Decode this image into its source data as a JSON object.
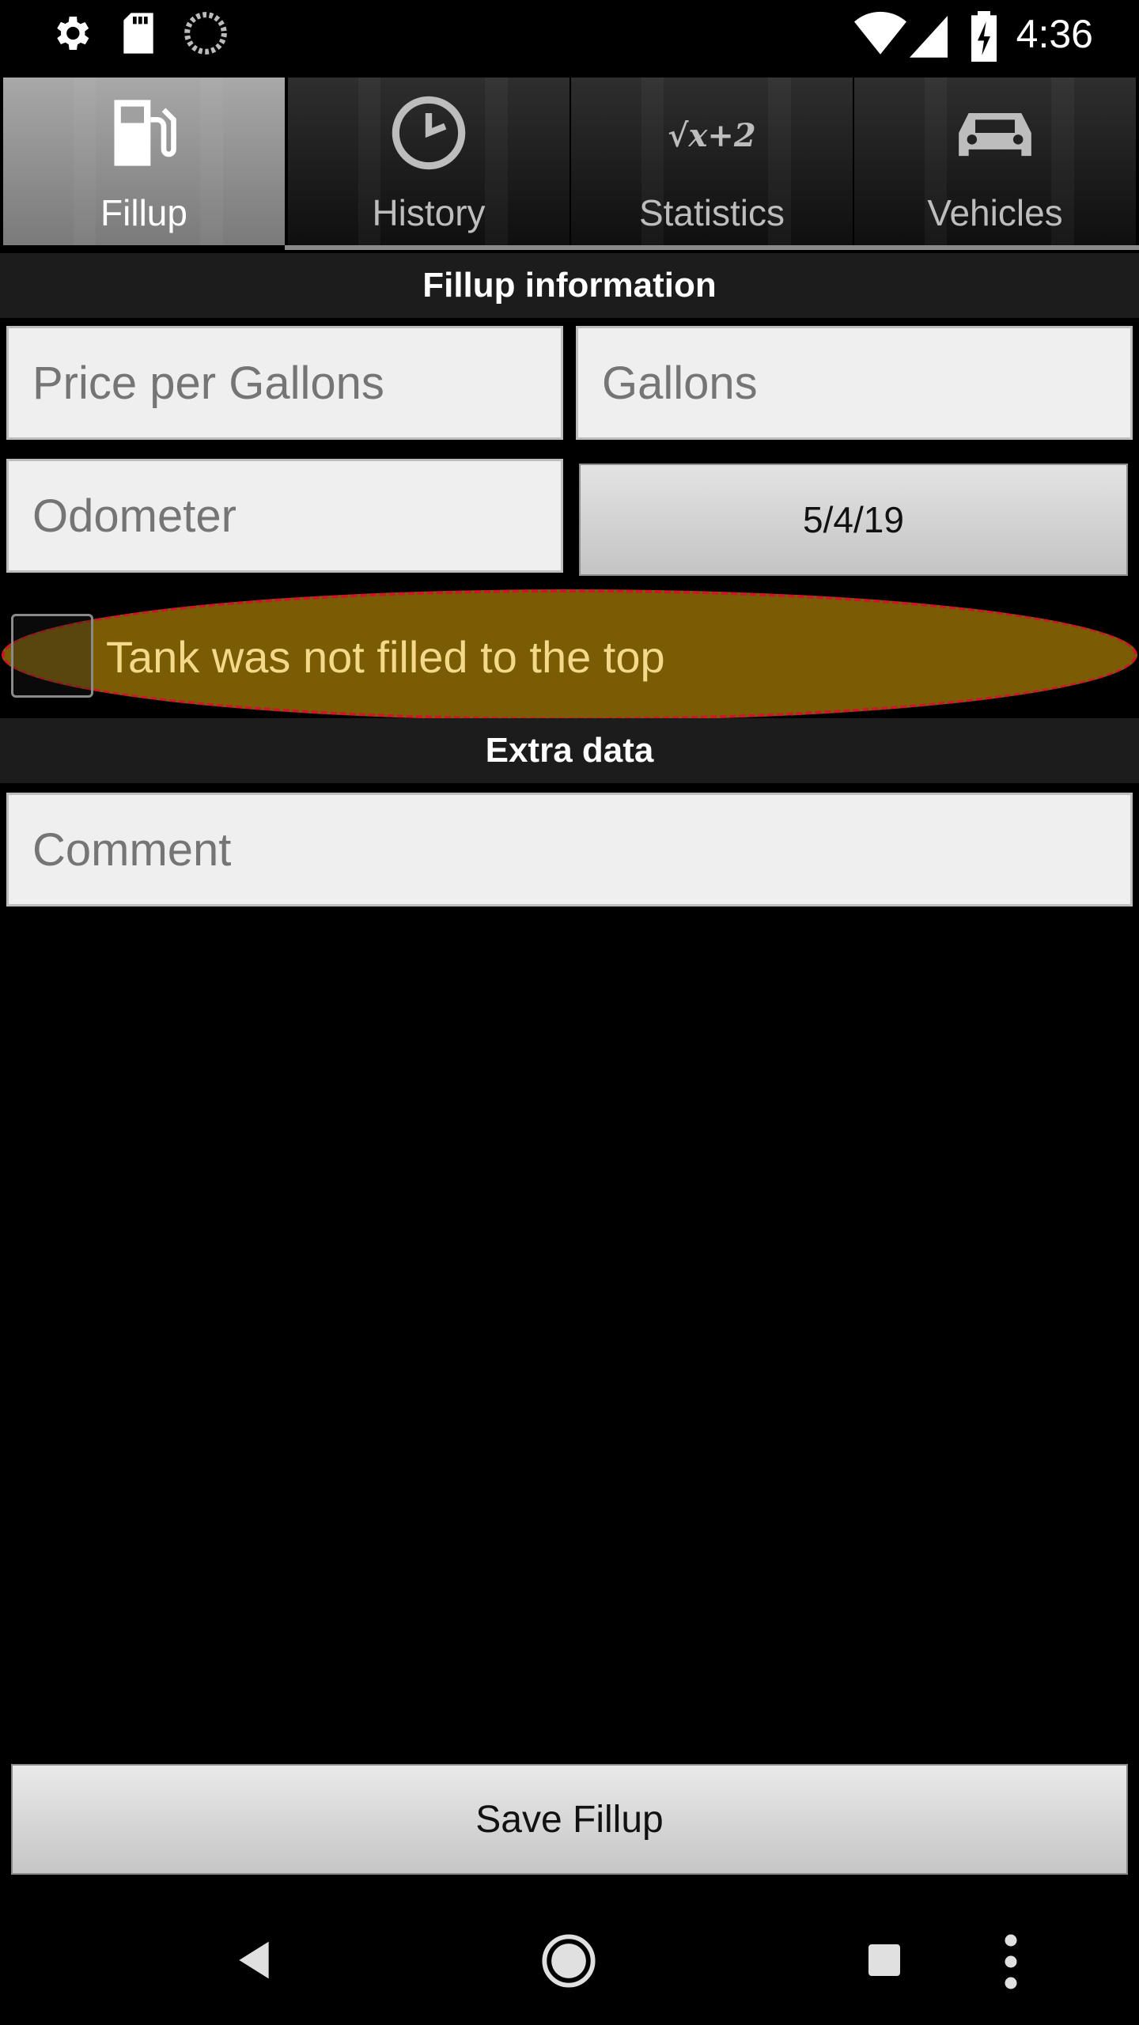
{
  "status_bar": {
    "time": "4:36",
    "icons": [
      "settings-icon",
      "sd-card-icon",
      "sync-spinner-icon",
      "wifi-icon",
      "cell-signal-icon",
      "battery-charging-icon"
    ]
  },
  "tabs": [
    {
      "label": "Fillup",
      "icon": "fuel-pump-icon",
      "active": true
    },
    {
      "label": "History",
      "icon": "clock-icon",
      "active": false
    },
    {
      "label": "Statistics",
      "icon": "formula-icon",
      "icon_text": "√x+2",
      "active": false
    },
    {
      "label": "Vehicles",
      "icon": "car-icon",
      "active": false
    }
  ],
  "fillup_section": {
    "title": "Fillup information",
    "price_placeholder": "Price per Gallons",
    "gallons_placeholder": "Gallons",
    "odometer_placeholder": "Odometer",
    "date": "5/4/19",
    "partial_fill_label": "Tank was not filled to the top",
    "partial_fill_checked": false
  },
  "extra_section": {
    "title": "Extra data",
    "comment_placeholder": "Comment"
  },
  "save_label": "Save Fillup",
  "colors": {
    "highlight_fill": "#7a5c05",
    "highlight_border": "#d0142a",
    "highlight_text": "#f5d98a"
  }
}
